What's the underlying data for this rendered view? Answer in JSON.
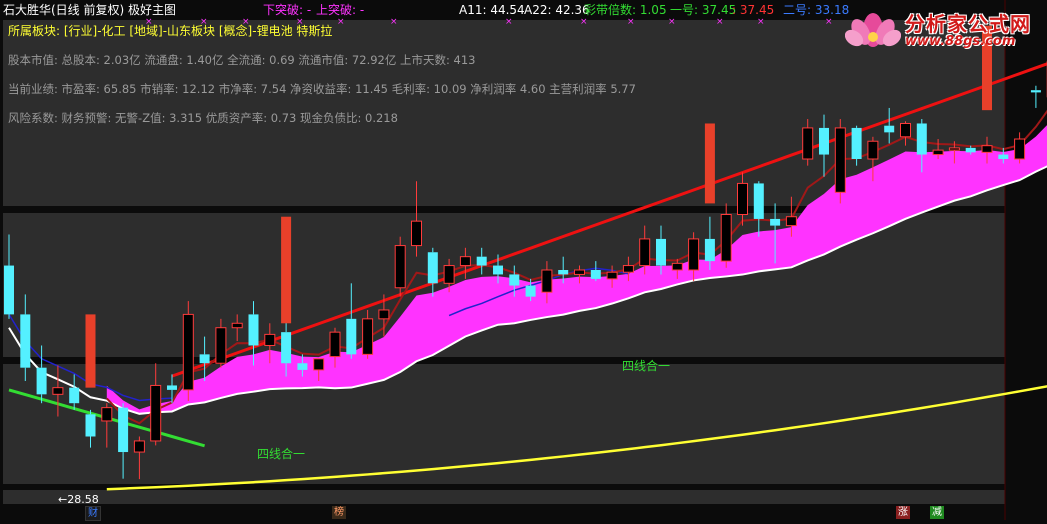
{
  "header": {
    "title": "石大胜华(日线 前复权) 极好主图",
    "breakdown": "下突破: -",
    "breakout": "上突破: -",
    "a11": "A11: 44.54",
    "a22": "A22: 42.36",
    "band_mult": "彩带倍数: 1.05",
    "line1": "一号: 37.45",
    "line1_b": ": 37.45",
    "line2": "二号: 33.18"
  },
  "sector": "所属板块: [行业]-化工 [地域]-山东板块 [概念]-锂电池 特斯拉",
  "info": {
    "equity": "股本市值: 总股本: 2.03亿 流通盘: 1.40亿 全流通: 0.69 流通市值: 72.92亿 上市天数: 413",
    "perf": "当前业绩: 市盈率: 65.85 市销率: 12.12 市净率: 7.54 净资收益率: 11.45 毛利率: 10.09 净利润率 4.60 主营利润率 5.77",
    "risk": "风险系数: 财务预警: 无警-Z值: 3.315 优质资产率: 0.73 现金负债比: 0.218"
  },
  "annotations": {
    "four_line_1": "四线合一",
    "four_line_2": "四线合一",
    "low_price": "←28.58"
  },
  "badges": {
    "cai": "财",
    "bang": "榜",
    "zhang": "涨",
    "jian": "减"
  },
  "logo": {
    "text": "分析家公式网",
    "url": "www.88gs.com"
  },
  "colors": {
    "up": "#ff3b3b",
    "down": "#54f0ff",
    "band": "#ff33ff",
    "ma_red": "#ee1111",
    "ma_yellow": "#ffff33",
    "ma_white": "#ffffff",
    "ma_blue": "#2222cc",
    "ma_green": "#33dd33",
    "ma_dark": "#a01818"
  },
  "chart_data": {
    "type": "candlestick",
    "price_low_label": 28.58,
    "candles": [
      {
        "o": 38.2,
        "h": 39.6,
        "l": 35.8,
        "c": 36.0
      },
      {
        "o": 36.0,
        "h": 36.9,
        "l": 33.0,
        "c": 33.6
      },
      {
        "o": 33.6,
        "h": 34.6,
        "l": 32.0,
        "c": 32.4
      },
      {
        "o": 32.4,
        "h": 33.7,
        "l": 31.4,
        "c": 32.7
      },
      {
        "o": 32.7,
        "h": 33.3,
        "l": 31.7,
        "c": 32.0
      },
      {
        "o": 31.5,
        "h": 31.7,
        "l": 30.0,
        "c": 30.5
      },
      {
        "o": 31.2,
        "h": 32.0,
        "l": 30.0,
        "c": 31.8
      },
      {
        "o": 31.8,
        "h": 32.0,
        "l": 28.6,
        "c": 29.8
      },
      {
        "o": 29.8,
        "h": 30.5,
        "l": 28.58,
        "c": 30.3
      },
      {
        "o": 30.3,
        "h": 33.8,
        "l": 30.1,
        "c": 32.8
      },
      {
        "o": 32.8,
        "h": 33.3,
        "l": 32.0,
        "c": 32.6
      },
      {
        "o": 32.6,
        "h": 36.6,
        "l": 32.1,
        "c": 36.0
      },
      {
        "o": 34.2,
        "h": 35.0,
        "l": 33.0,
        "c": 33.8
      },
      {
        "o": 33.8,
        "h": 35.8,
        "l": 33.6,
        "c": 35.4
      },
      {
        "o": 35.4,
        "h": 36.0,
        "l": 34.8,
        "c": 35.6
      },
      {
        "o": 36.0,
        "h": 36.6,
        "l": 33.7,
        "c": 34.6
      },
      {
        "o": 34.6,
        "h": 35.6,
        "l": 33.8,
        "c": 35.1
      },
      {
        "o": 35.2,
        "h": 36.2,
        "l": 33.2,
        "c": 33.8
      },
      {
        "o": 33.8,
        "h": 34.2,
        "l": 33.2,
        "c": 33.5
      },
      {
        "o": 33.5,
        "h": 34.0,
        "l": 33.0,
        "c": 34.0
      },
      {
        "o": 34.1,
        "h": 35.4,
        "l": 33.6,
        "c": 35.2
      },
      {
        "o": 35.8,
        "h": 37.4,
        "l": 34.0,
        "c": 34.2
      },
      {
        "o": 34.2,
        "h": 36.2,
        "l": 34.0,
        "c": 35.8
      },
      {
        "o": 35.8,
        "h": 36.9,
        "l": 35.0,
        "c": 36.2
      },
      {
        "o": 37.2,
        "h": 39.5,
        "l": 36.8,
        "c": 39.1
      },
      {
        "o": 39.1,
        "h": 42.0,
        "l": 38.6,
        "c": 40.2
      },
      {
        "o": 38.8,
        "h": 39.0,
        "l": 36.8,
        "c": 37.4
      },
      {
        "o": 37.4,
        "h": 38.5,
        "l": 37.0,
        "c": 38.2
      },
      {
        "o": 38.2,
        "h": 39.0,
        "l": 37.6,
        "c": 38.6
      },
      {
        "o": 38.6,
        "h": 39.0,
        "l": 37.8,
        "c": 38.2
      },
      {
        "o": 38.2,
        "h": 38.7,
        "l": 37.4,
        "c": 37.8
      },
      {
        "o": 37.8,
        "h": 38.2,
        "l": 36.8,
        "c": 37.3
      },
      {
        "o": 37.3,
        "h": 37.6,
        "l": 36.6,
        "c": 36.8
      },
      {
        "o": 37.0,
        "h": 38.4,
        "l": 36.5,
        "c": 38.0
      },
      {
        "o": 38.0,
        "h": 38.6,
        "l": 37.4,
        "c": 37.8
      },
      {
        "o": 37.8,
        "h": 38.2,
        "l": 37.4,
        "c": 38.0
      },
      {
        "o": 38.0,
        "h": 38.4,
        "l": 37.5,
        "c": 37.6
      },
      {
        "o": 37.6,
        "h": 38.2,
        "l": 37.2,
        "c": 37.9
      },
      {
        "o": 37.9,
        "h": 38.6,
        "l": 37.5,
        "c": 38.2
      },
      {
        "o": 38.2,
        "h": 40.0,
        "l": 37.8,
        "c": 39.4
      },
      {
        "o": 39.4,
        "h": 40.0,
        "l": 37.8,
        "c": 38.2
      },
      {
        "o": 38.0,
        "h": 38.5,
        "l": 37.6,
        "c": 38.3
      },
      {
        "o": 38.0,
        "h": 39.7,
        "l": 37.5,
        "c": 39.4
      },
      {
        "o": 39.4,
        "h": 40.4,
        "l": 38.0,
        "c": 38.4
      },
      {
        "o": 38.4,
        "h": 41.0,
        "l": 38.1,
        "c": 40.5
      },
      {
        "o": 40.5,
        "h": 42.4,
        "l": 40.0,
        "c": 41.9
      },
      {
        "o": 41.9,
        "h": 42.0,
        "l": 39.5,
        "c": 40.3
      },
      {
        "o": 40.3,
        "h": 41.0,
        "l": 38.3,
        "c": 40.0
      },
      {
        "o": 40.0,
        "h": 41.3,
        "l": 39.5,
        "c": 40.4
      },
      {
        "o": 43.0,
        "h": 44.8,
        "l": 42.7,
        "c": 44.4
      },
      {
        "o": 44.4,
        "h": 45.0,
        "l": 42.2,
        "c": 43.2
      },
      {
        "o": 41.5,
        "h": 44.8,
        "l": 41.0,
        "c": 44.4
      },
      {
        "o": 44.4,
        "h": 44.5,
        "l": 42.7,
        "c": 43.0
      },
      {
        "o": 43.0,
        "h": 44.0,
        "l": 42.0,
        "c": 43.8
      },
      {
        "o": 44.5,
        "h": 45.3,
        "l": 43.7,
        "c": 44.2
      },
      {
        "o": 44.0,
        "h": 44.7,
        "l": 43.6,
        "c": 44.6
      },
      {
        "o": 44.6,
        "h": 44.8,
        "l": 42.4,
        "c": 43.2
      },
      {
        "o": 43.2,
        "h": 43.9,
        "l": 43.0,
        "c": 43.4
      },
      {
        "o": 43.4,
        "h": 43.8,
        "l": 42.8,
        "c": 43.5
      },
      {
        "o": 43.5,
        "h": 43.6,
        "l": 43.2,
        "c": 43.3
      },
      {
        "o": 43.3,
        "h": 44.0,
        "l": 42.8,
        "c": 43.6
      },
      {
        "o": 43.2,
        "h": 43.5,
        "l": 42.8,
        "c": 43.0
      },
      {
        "o": 43.0,
        "h": 44.2,
        "l": 42.8,
        "c": 43.9
      },
      {
        "o": 46.1,
        "h": 46.3,
        "l": 45.3,
        "c": 46.0
      },
      {
        "o": 45.8,
        "h": 47.9,
        "l": 45.3,
        "c": 47.4
      },
      {
        "o": 44.6,
        "h": 45.6,
        "l": 44.0,
        "c": 45.1
      },
      {
        "o": 45.1,
        "h": 45.3,
        "l": 44.4,
        "c": 44.6
      },
      {
        "o": 45.5,
        "h": 46.8,
        "l": 45.2,
        "c": 46.3
      },
      {
        "o": 46.3,
        "h": 48.2,
        "l": 46.0,
        "c": 48.0
      }
    ],
    "up_color": "#ff3b3b",
    "down_color": "#54f0ff",
    "ma": [
      {
        "name": "一号",
        "color": "#a01818"
      },
      {
        "name": "二号",
        "color": "#ee1111"
      },
      {
        "name": "",
        "color": "#ffff33"
      }
    ]
  }
}
